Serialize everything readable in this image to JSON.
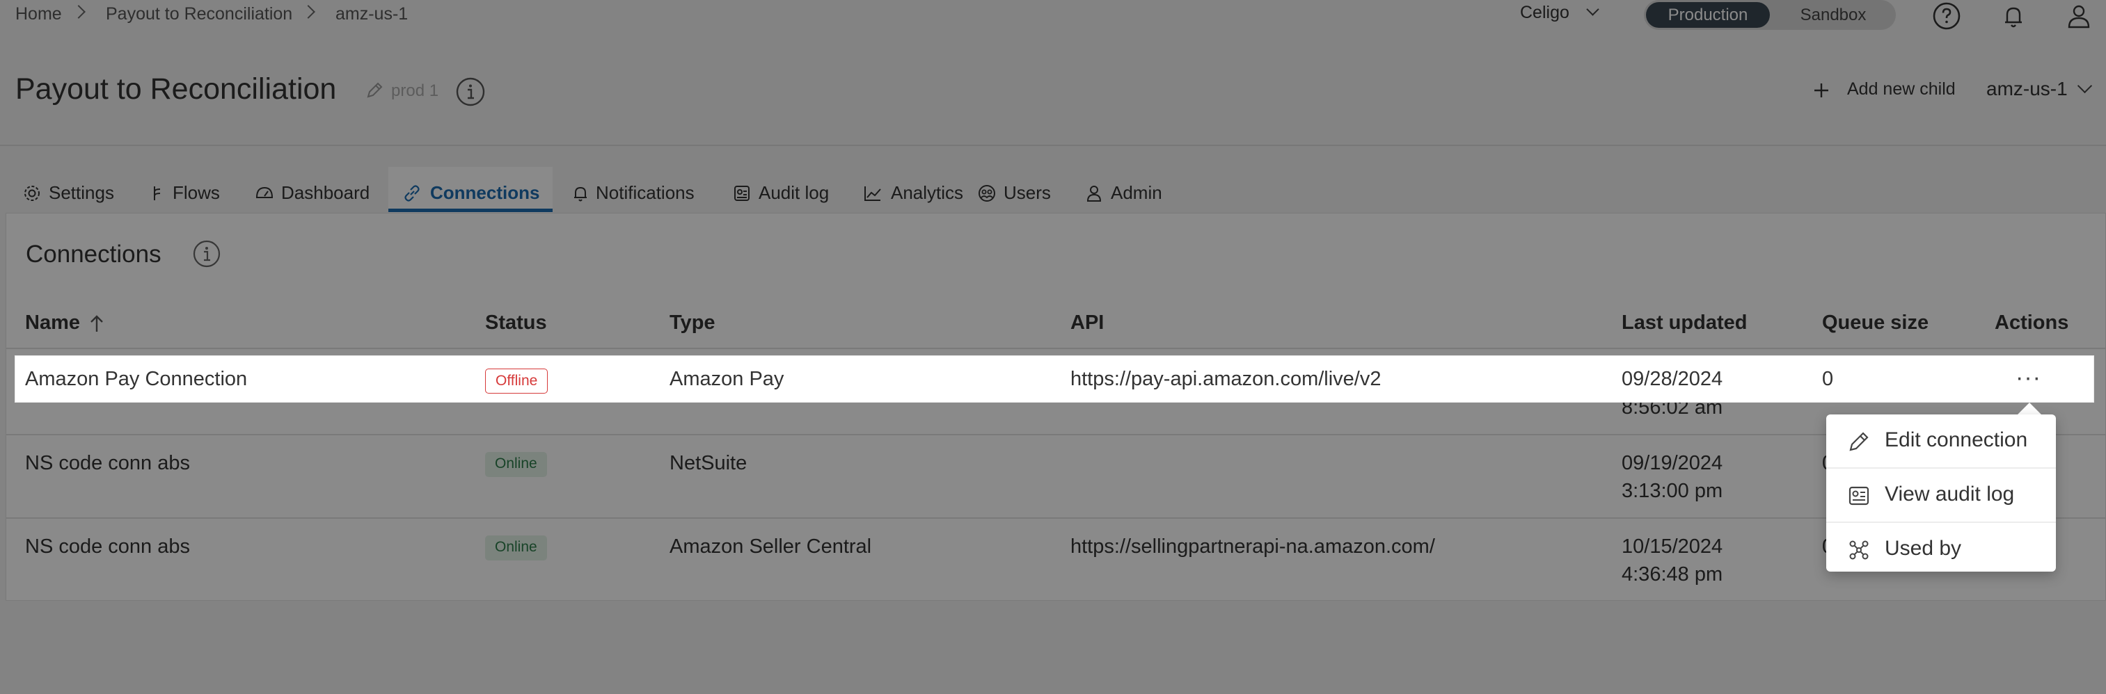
{
  "breadcrumb": {
    "items": [
      "Home",
      "Payout to Reconciliation",
      "amz-us-1"
    ]
  },
  "account": {
    "label": "Celigo"
  },
  "environment": {
    "production_label": "Production",
    "sandbox_label": "Sandbox",
    "selected": "Production"
  },
  "header": {
    "title": "Payout to Reconciliation",
    "env_tag": "prod 1",
    "add_child_label": "Add new child",
    "child_selector_value": "amz-us-1"
  },
  "tabs": [
    {
      "label": "Settings",
      "icon": "gear-icon"
    },
    {
      "label": "Flows",
      "icon": "flow-icon"
    },
    {
      "label": "Dashboard",
      "icon": "dashboard-icon"
    },
    {
      "label": "Connections",
      "icon": "link-icon",
      "active": true
    },
    {
      "label": "Notifications",
      "icon": "bell-icon"
    },
    {
      "label": "Audit log",
      "icon": "audit-log-icon"
    },
    {
      "label": "Analytics",
      "icon": "analytics-icon"
    },
    {
      "label": "Users",
      "icon": "users-icon"
    },
    {
      "label": "Admin",
      "icon": "user-icon"
    }
  ],
  "connections": {
    "title": "Connections",
    "columns": [
      "Name",
      "Status",
      "Type",
      "API",
      "Last updated",
      "Queue size",
      "Actions"
    ],
    "rows": [
      {
        "name": "Amazon Pay Connection",
        "status": "Offline",
        "type": "Amazon Pay",
        "api": "https://pay-api.amazon.com/live/v2",
        "updated_date": "09/28/2024",
        "updated_time": "8:56:02 am",
        "queue": "0"
      },
      {
        "name": "NS code conn abs",
        "status": "Online",
        "type": "NetSuite",
        "api": "",
        "updated_date": "09/19/2024",
        "updated_time": "3:13:00 pm",
        "queue": "0"
      },
      {
        "name": "NS code conn abs",
        "status": "Online",
        "type": "Amazon Seller Central",
        "api": "https://sellingpartnerapi-na.amazon.com/",
        "updated_date": "10/15/2024",
        "updated_time": "4:36:48 pm",
        "queue": "0"
      }
    ],
    "actions_glyph": "···"
  },
  "actions_menu": {
    "items": [
      {
        "label": "Edit connection",
        "icon": "pencil-icon"
      },
      {
        "label": "View audit log",
        "icon": "audit-log-icon"
      },
      {
        "label": "Used by",
        "icon": "used-by-icon"
      }
    ]
  },
  "colors": {
    "accent": "#1d6cb0",
    "offline": "#d63a3a",
    "online": "#2e7d4a",
    "production_toggle": "#3a4752"
  }
}
